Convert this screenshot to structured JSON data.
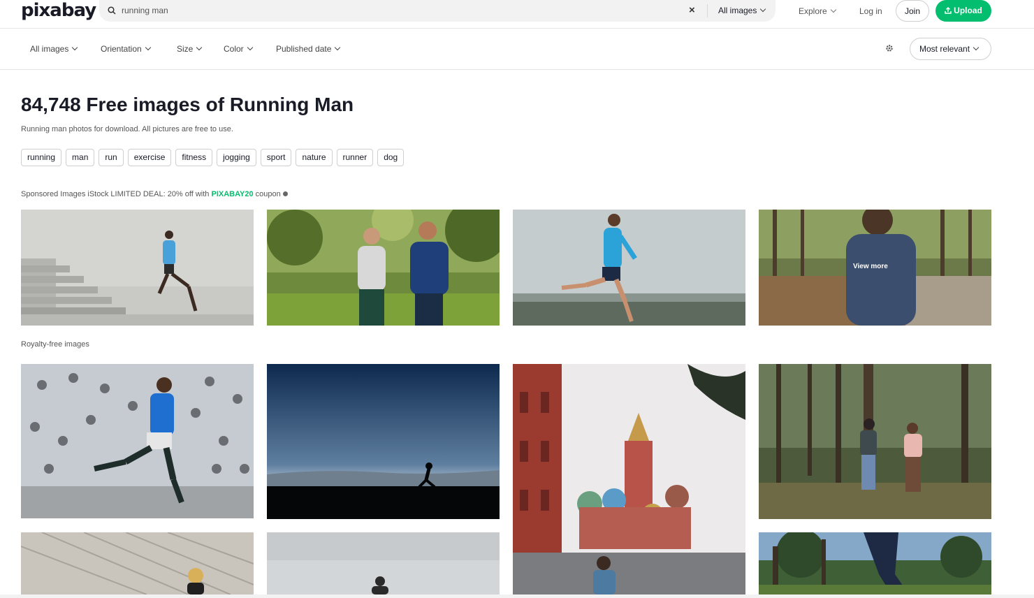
{
  "header": {
    "logo": "pixabay",
    "search_value": "running man",
    "clear_label": "×",
    "scope_label": "All images",
    "explore_label": "Explore",
    "login_label": "Log in",
    "join_label": "Join",
    "upload_label": "Upload"
  },
  "filters": {
    "items": [
      "All images",
      "Orientation",
      "Size",
      "Color",
      "Published date"
    ],
    "sort_label": "Most relevant"
  },
  "main": {
    "title": "84,748 Free images of Running Man",
    "subtitle": "Running man photos for download. All pictures are free to use.",
    "tags": [
      "running",
      "man",
      "run",
      "exercise",
      "fitness",
      "jogging",
      "sport",
      "nature",
      "runner",
      "dog"
    ],
    "sponsored_prefix": "Sponsored Images iStock LIMITED DEAL: 20% off with ",
    "sponsored_code": "PIXABAY20",
    "sponsored_suffix": " coupon",
    "view_more_label": "View more",
    "royalty_label": "Royalty-free images"
  },
  "colors": {
    "brand_green": "#02be6e",
    "text_dark": "#191b26"
  }
}
